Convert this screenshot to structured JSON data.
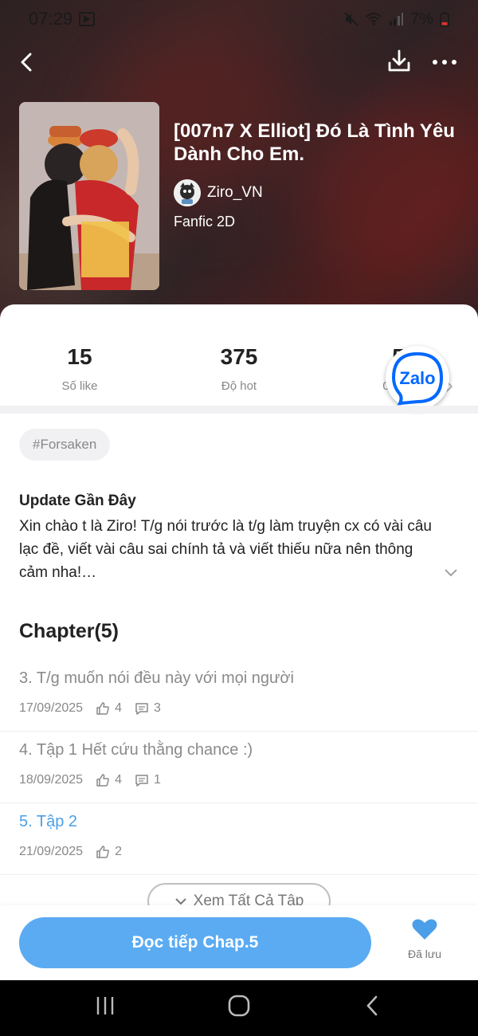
{
  "status_bar": {
    "time": "07:29",
    "battery": "7%",
    "icons": [
      "youtube-icon",
      "mute-icon",
      "wifi-icon",
      "signal-icon",
      "battery-low-icon"
    ]
  },
  "top_bar": {
    "icons": [
      "back-arrow-icon",
      "download-icon",
      "more-icon"
    ]
  },
  "story": {
    "title": "[007n7 X Elliot] Đó Là Tình Yêu Dành Cho Em.",
    "author": "Ziro_VN",
    "genre": "Fanfic 2D"
  },
  "stats": [
    {
      "value": "15",
      "label": "Số like"
    },
    {
      "value": "375",
      "label": "Độ hot"
    },
    {
      "value": "5",
      "label": "0 ngư"
    }
  ],
  "zalo_label": "Zalo",
  "tag": "#Forsaken",
  "update": {
    "title": "Update Gần Đây",
    "text": "Xin chào t là Ziro! T/g nói trước là t/g làm truyện cx có vài câu lạc đề, viết vài câu sai chính tả và viết thiếu nữa nên thông cảm nha!…"
  },
  "chapters": {
    "heading": "Chapter(5)",
    "items": [
      {
        "name": "3. T/g muốn nói đều này với mọi người",
        "date": "17/09/2025",
        "likes": "4",
        "comments": "3"
      },
      {
        "name": "4. Tập 1 Hết cứu thằng chance :)",
        "date": "18/09/2025",
        "likes": "4",
        "comments": "1"
      },
      {
        "name": "5. Tập 2",
        "date": "21/09/2025",
        "likes": "2"
      }
    ],
    "see_all": "Xem Tất Cả Tập"
  },
  "bottom": {
    "read_button": "Đọc tiếp Chap.5",
    "saved_label": "Đã lưu"
  },
  "colors": {
    "accent": "#5aabf2",
    "active_chapter": "#4a9fe8",
    "zalo_blue": "#0068ff"
  }
}
